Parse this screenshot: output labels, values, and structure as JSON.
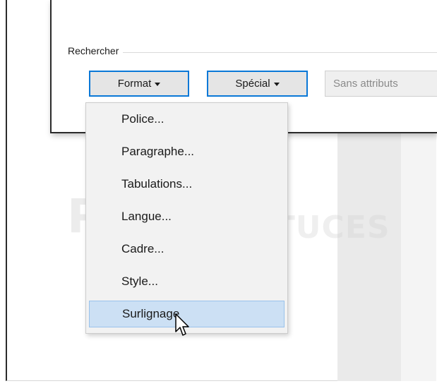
{
  "search_group": {
    "label": "Rechercher"
  },
  "buttons": {
    "format_label": "Format",
    "special_label": "Spécial",
    "no_attributes_label": "Sans attributs"
  },
  "format_menu": {
    "items": [
      {
        "label": "Police..."
      },
      {
        "label": "Paragraphe..."
      },
      {
        "label": "Tabulations..."
      },
      {
        "label": "Langue..."
      },
      {
        "label": "Cadre..."
      },
      {
        "label": "Style..."
      },
      {
        "label": "Surlignage"
      }
    ],
    "highlighted_index": 6
  },
  "watermark": {
    "large_text": "PC",
    "small_text": "ASTUCES"
  },
  "colors": {
    "focus_border": "#0a78d7",
    "menu_highlight": "#cce0f4",
    "menu_background": "#f2f2f2"
  }
}
